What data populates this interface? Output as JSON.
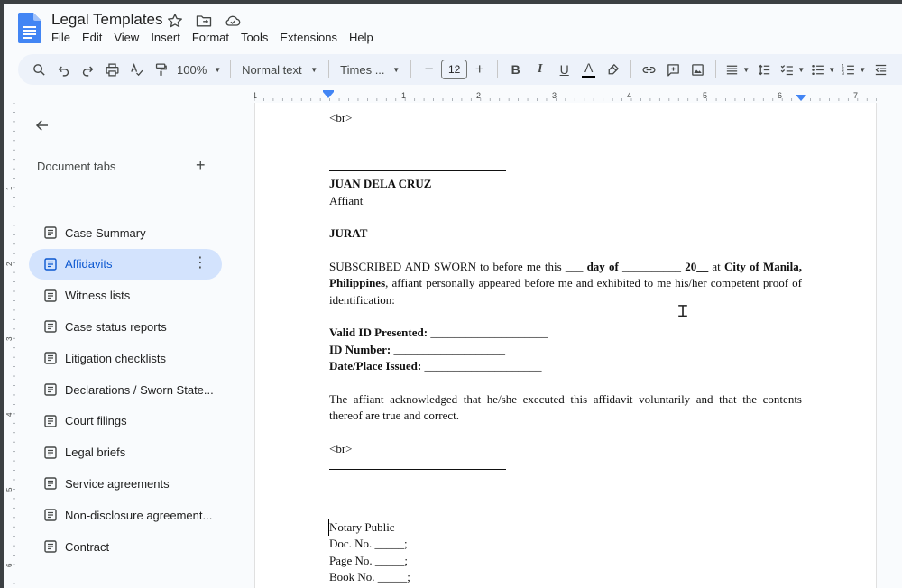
{
  "app": {
    "title": "Legal Templates",
    "menu": [
      "File",
      "Edit",
      "View",
      "Insert",
      "Format",
      "Tools",
      "Extensions",
      "Help"
    ]
  },
  "toolbar": {
    "zoom": "100%",
    "style": "Normal text",
    "font": "Times ...",
    "font_size": "12",
    "minus": "−",
    "plus": "+"
  },
  "ruler": {
    "labels": [
      "1",
      "1",
      "2",
      "3",
      "4",
      "5",
      "6",
      "7"
    ],
    "left_labels": [
      "1",
      "2",
      "3",
      "4",
      "5",
      "6"
    ]
  },
  "sidebar": {
    "title": "Document tabs",
    "add": "+",
    "tabs": [
      {
        "label": "Case Summary",
        "active": false
      },
      {
        "label": "Affidavits",
        "active": true
      },
      {
        "label": "Witness lists",
        "active": false
      },
      {
        "label": "Case status reports",
        "active": false
      },
      {
        "label": "Litigation checklists",
        "active": false
      },
      {
        "label": "Declarations / Sworn State...",
        "active": false
      },
      {
        "label": "Court filings",
        "active": false
      },
      {
        "label": "Legal briefs",
        "active": false
      },
      {
        "label": "Service agreements",
        "active": false
      },
      {
        "label": "Non-disclosure agreement...",
        "active": false
      },
      {
        "label": "Contract",
        "active": false
      }
    ]
  },
  "document": {
    "br1": "<br>",
    "affiant_name": "JUAN DELA CRUZ",
    "affiant_role": "Affiant",
    "jurat_title": "JURAT",
    "subscribed_1": "SUBSCRIBED AND SWORN to before me this ___ ",
    "subscribed_day": "day of",
    "subscribed_2": " __________ ",
    "subscribed_year": "20__",
    "subscribed_3": " at ",
    "subscribed_city": "City of Manila, Philippines",
    "subscribed_4": ", affiant personally appeared before me and exhibited to me his/her competent proof of identification:",
    "valid_id_label": "Valid ID Presented:",
    "valid_id_blank": " ____________________",
    "id_number_label": "ID Number:",
    "id_number_blank": " ___________________",
    "date_place_label": "Date/Place Issued:",
    "date_place_blank": " ____________________",
    "acknowledged": "The affiant acknowledged that he/she executed this affidavit voluntarily and that the contents thereof are true and correct.",
    "br2": "<br>",
    "notary_public": "Notary Public",
    "doc_no": "Doc. No. _____;",
    "page_no": "Page No. _____;",
    "book_no": "Book No. _____;"
  },
  "colors": {
    "toolbar_bg": "#edf2fa",
    "active_tab_bg": "#d3e3fd",
    "active_tab_text": "#0b57d0",
    "ruler_marker": "#4285f4"
  }
}
